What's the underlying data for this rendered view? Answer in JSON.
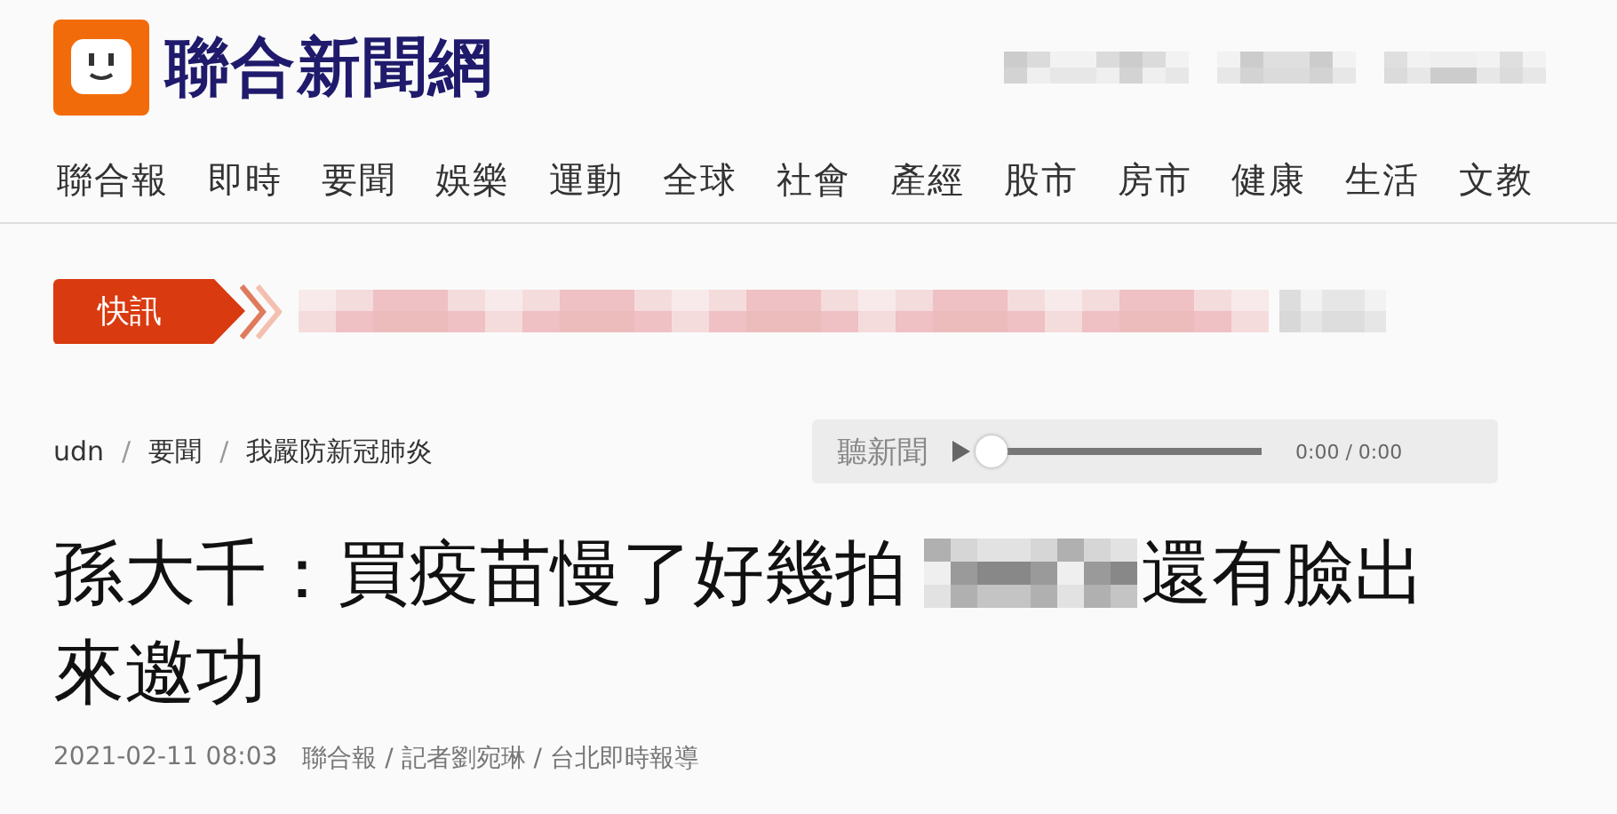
{
  "site": {
    "title": "聯合新聞網"
  },
  "nav": [
    "聯合報",
    "即時",
    "要聞",
    "娛樂",
    "運動",
    "全球",
    "社會",
    "產經",
    "股市",
    "房市",
    "健康",
    "生活",
    "文教"
  ],
  "breaking": {
    "label": "快訊"
  },
  "breadcrumb": [
    {
      "kind": "link",
      "text": "udn"
    },
    {
      "kind": "separator",
      "text": "/"
    },
    {
      "kind": "link",
      "text": "要聞"
    },
    {
      "kind": "separator",
      "text": "/"
    },
    {
      "kind": "link",
      "text": "我嚴防新冠肺炎"
    }
  ],
  "audio": {
    "label": "聽新聞",
    "level": 0,
    "time": "0:00 / 0:00"
  },
  "headline": [
    [
      {
        "kind": "text",
        "text": "孫大千：買疫苗慢了好幾拍"
      },
      {
        "kind": "redacted"
      },
      {
        "kind": "text",
        "text": "還有臉出"
      }
    ],
    [
      {
        "kind": "text",
        "text": "來邀功"
      }
    ]
  ],
  "meta": {
    "datetime": "2021-02-11 08:03",
    "byline": "聯合報 / 記者劉宛琳 / 台北即時報導"
  }
}
